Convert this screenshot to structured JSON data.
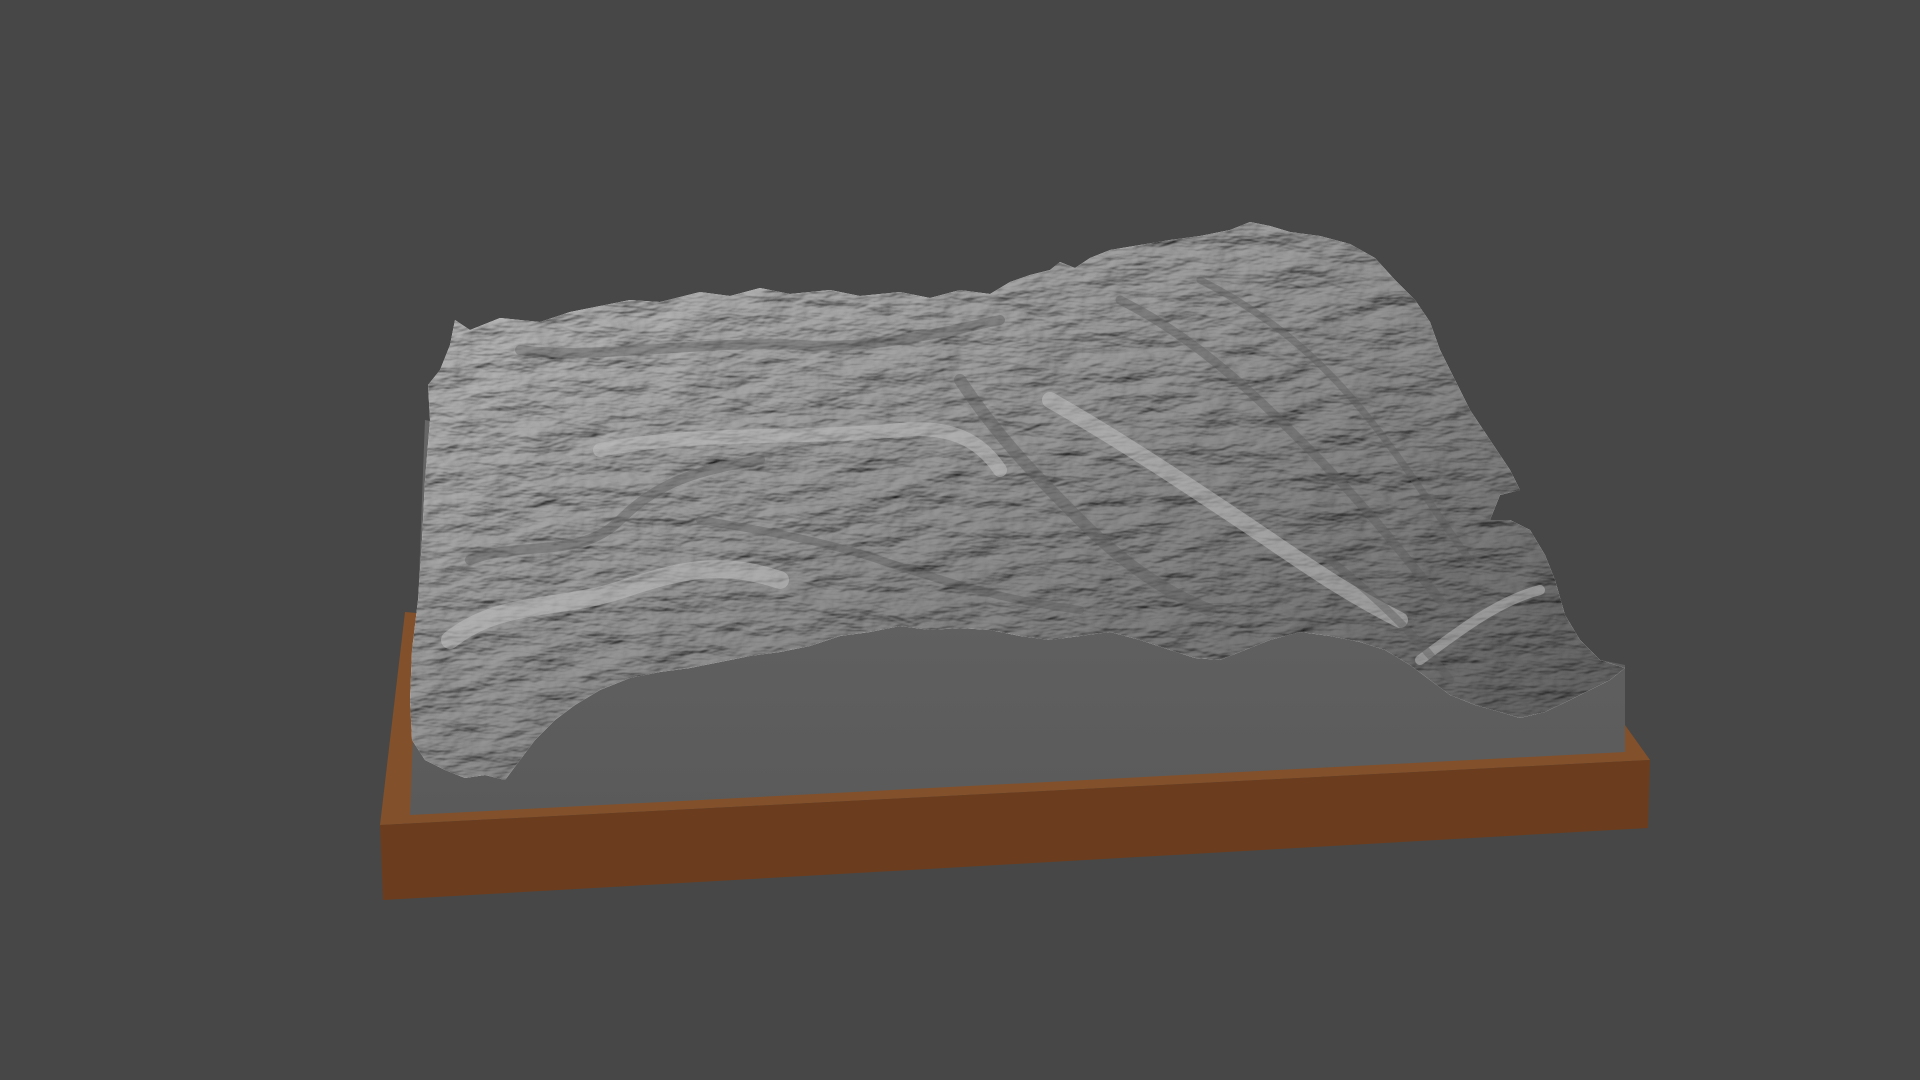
{
  "scene": {
    "background_color": "#474747",
    "terrain": {
      "surface_color": "#9a9a9a",
      "highlight_color": "#c4c4c4",
      "shadow_color": "#5e5e5e",
      "side_color": "#666666",
      "side_shadow_color": "#5a5a5a"
    },
    "base": {
      "front_color": "#6b3d1e",
      "top_color": "#82502b",
      "side_color": "#5c3419"
    }
  }
}
